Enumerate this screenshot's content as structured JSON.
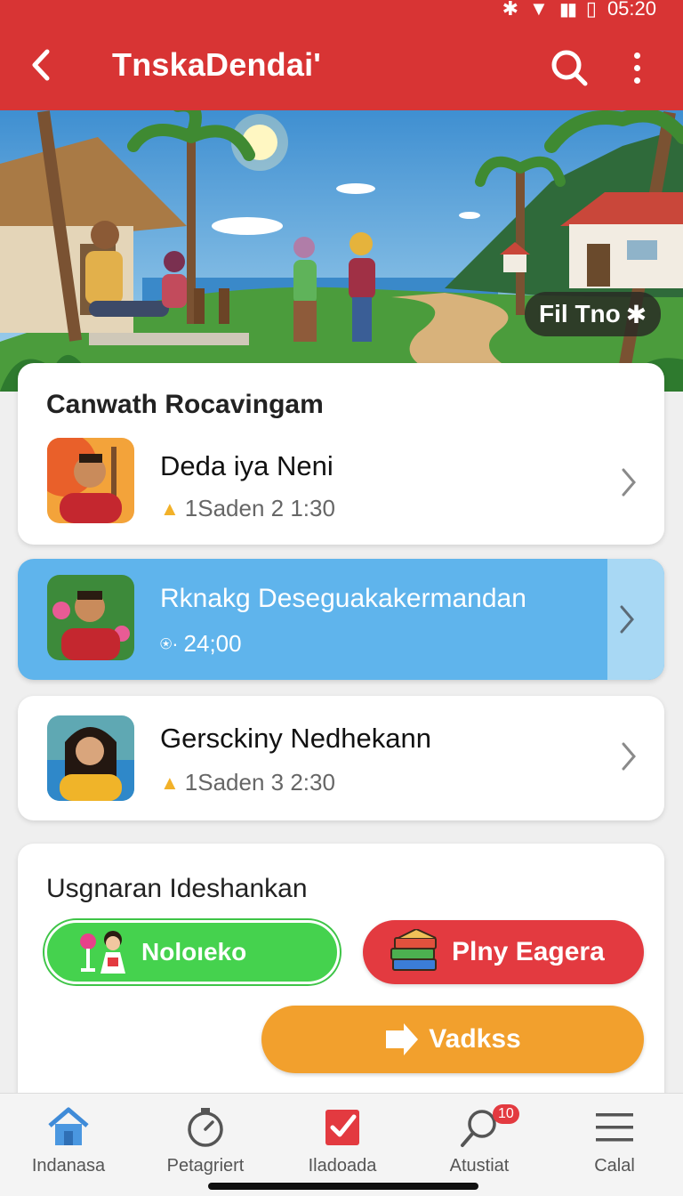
{
  "status_bar": {
    "time": "05:20"
  },
  "app_bar": {
    "title": "TnskaDendai'"
  },
  "hero": {
    "badge_label": "Fil Tno"
  },
  "section1": {
    "title_prefix": "Canwath",
    "title_bold": "Rocavingam",
    "items": [
      {
        "title": "Deda iya Neni",
        "meta": "1Saden 2 1:30"
      },
      {
        "title": "Rknakg Deseguakakermandan",
        "meta": "24;00"
      },
      {
        "title": "Gersckiny Nedhekann",
        "meta": "1Saden 3 2:30"
      }
    ]
  },
  "section2": {
    "title": "Usgnaran Ideshankan",
    "buttons": {
      "green": "Noloıeko",
      "red": "Plny Eagera",
      "orange": "Vadkss"
    }
  },
  "bottom_nav": {
    "items": [
      {
        "label": "Indanasa",
        "icon": "home-icon"
      },
      {
        "label": "Petagriert",
        "icon": "stopwatch-icon"
      },
      {
        "label": "Iladoada",
        "icon": "checkbox-icon"
      },
      {
        "label": "Atustiat",
        "icon": "search-icon",
        "badge": "10"
      },
      {
        "label": "Calal",
        "icon": "menu-icon"
      }
    ]
  },
  "colors": {
    "app_bar": "#d83434",
    "highlight_card": "#5fb4ec",
    "green_button": "#45d24e",
    "red_button": "#e33a40",
    "orange_button": "#f2a02d"
  }
}
